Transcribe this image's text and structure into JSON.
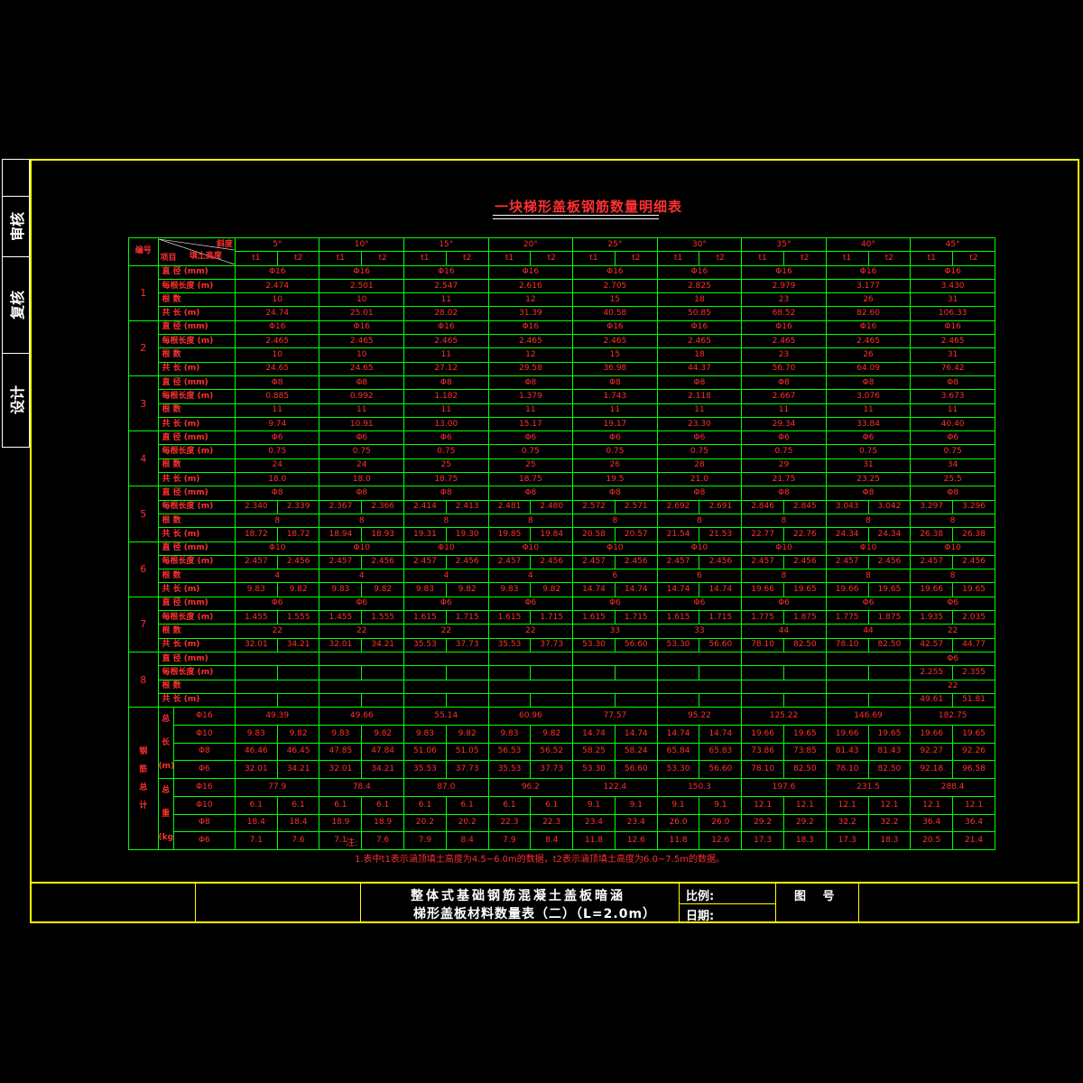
{
  "side": [
    "审核",
    "复核",
    "设计"
  ],
  "title": "一块梯形盖板钢筋数量明细表",
  "header": {
    "no_label": "编号",
    "angle_label": "斜度",
    "item_label": "项目",
    "fill_label": "填土高度",
    "angles": [
      "5°",
      "10°",
      "15°",
      "20°",
      "25°",
      "30°",
      "35°",
      "40°",
      "45°"
    ],
    "t1": "t1",
    "t2": "t2"
  },
  "row_labels": {
    "dia": "直 径 (mm)",
    "len": "每根长度 (m)",
    "cnt": "根 数",
    "tot": "共 长 (m)"
  },
  "groups": [
    {
      "no": "1",
      "rows": [
        {
          "k": "dia",
          "cells": [
            "Φ16",
            "Φ16",
            "Φ16",
            "Φ16",
            "Φ16",
            "Φ16",
            "Φ16",
            "Φ16",
            "Φ16"
          ]
        },
        {
          "k": "len",
          "cells": [
            "2.474",
            "2.501",
            "2.547",
            "2.616",
            "2.705",
            "2.825",
            "2.979",
            "3.177",
            "3.430"
          ]
        },
        {
          "k": "cnt",
          "cells": [
            "10",
            "10",
            "11",
            "12",
            "15",
            "18",
            "23",
            "26",
            "31"
          ]
        },
        {
          "k": "tot",
          "cells": [
            "24.74",
            "25.01",
            "28.02",
            "31.39",
            "40.58",
            "50.85",
            "68.52",
            "82.60",
            "106.33"
          ]
        }
      ]
    },
    {
      "no": "2",
      "rows": [
        {
          "k": "dia",
          "cells": [
            "Φ16",
            "Φ16",
            "Φ16",
            "Φ16",
            "Φ16",
            "Φ16",
            "Φ16",
            "Φ16",
            "Φ16"
          ]
        },
        {
          "k": "len",
          "cells": [
            "2.465",
            "2.465",
            "2.465",
            "2.465",
            "2.465",
            "2.465",
            "2.465",
            "2.465",
            "2.465"
          ]
        },
        {
          "k": "cnt",
          "cells": [
            "10",
            "10",
            "11",
            "12",
            "15",
            "18",
            "23",
            "26",
            "31"
          ]
        },
        {
          "k": "tot",
          "cells": [
            "24.65",
            "24.65",
            "27.12",
            "29.58",
            "36.98",
            "44.37",
            "56.70",
            "64.09",
            "76.42"
          ]
        }
      ]
    },
    {
      "no": "3",
      "rows": [
        {
          "k": "dia",
          "cells": [
            "Φ8",
            "Φ8",
            "Φ8",
            "Φ8",
            "Φ8",
            "Φ8",
            "Φ8",
            "Φ8",
            "Φ8"
          ]
        },
        {
          "k": "len",
          "cells": [
            "0.885",
            "0.992",
            "1.182",
            "1.379",
            "1.743",
            "2.118",
            "2.667",
            "3.076",
            "3.673"
          ]
        },
        {
          "k": "cnt",
          "cells": [
            "11",
            "11",
            "11",
            "11",
            "11",
            "11",
            "11",
            "11",
            "11"
          ]
        },
        {
          "k": "tot",
          "cells": [
            "9.74",
            "10.91",
            "13.00",
            "15.17",
            "19.17",
            "23.30",
            "29.34",
            "33.84",
            "40.40"
          ]
        }
      ]
    },
    {
      "no": "4",
      "rows": [
        {
          "k": "dia",
          "cells": [
            "Φ6",
            "Φ6",
            "Φ6",
            "Φ6",
            "Φ6",
            "Φ6",
            "Φ6",
            "Φ6",
            "Φ6"
          ]
        },
        {
          "k": "len",
          "cells": [
            "0.75",
            "0.75",
            "0.75",
            "0.75",
            "0.75",
            "0.75",
            "0.75",
            "0.75",
            "0.75"
          ]
        },
        {
          "k": "cnt",
          "cells": [
            "24",
            "24",
            "25",
            "25",
            "26",
            "28",
            "29",
            "31",
            "34"
          ]
        },
        {
          "k": "tot",
          "cells": [
            "18.0",
            "18.0",
            "18.75",
            "18.75",
            "19.5",
            "21.0",
            "21.75",
            "23.25",
            "25.5"
          ]
        }
      ]
    },
    {
      "no": "5",
      "rows": [
        {
          "k": "dia",
          "cells": [
            "Φ8",
            "Φ8",
            "Φ8",
            "Φ8",
            "Φ8",
            "Φ8",
            "Φ8",
            "Φ8",
            "Φ8"
          ]
        },
        {
          "k": "len",
          "split": true,
          "cells": [
            [
              "2.340",
              "2.339"
            ],
            [
              "2.367",
              "2.366"
            ],
            [
              "2.414",
              "2.413"
            ],
            [
              "2.481",
              "2.480"
            ],
            [
              "2.572",
              "2.571"
            ],
            [
              "2.692",
              "2.691"
            ],
            [
              "2.846",
              "2.845"
            ],
            [
              "3.043",
              "3.042"
            ],
            [
              "3.297",
              "3.296"
            ]
          ]
        },
        {
          "k": "cnt",
          "cells": [
            "8",
            "8",
            "8",
            "8",
            "8",
            "8",
            "8",
            "8",
            "8"
          ]
        },
        {
          "k": "tot",
          "split": true,
          "cells": [
            [
              "18.72",
              "18.72"
            ],
            [
              "18.94",
              "18.93"
            ],
            [
              "19.31",
              "19.30"
            ],
            [
              "19.85",
              "19.84"
            ],
            [
              "20.58",
              "20.57"
            ],
            [
              "21.54",
              "21.53"
            ],
            [
              "22.77",
              "22.76"
            ],
            [
              "24.34",
              "24.34"
            ],
            [
              "26.38",
              "26.38"
            ]
          ]
        }
      ]
    },
    {
      "no": "6",
      "rows": [
        {
          "k": "dia",
          "cells": [
            "Φ10",
            "Φ10",
            "Φ10",
            "Φ10",
            "Φ10",
            "Φ10",
            "Φ10",
            "Φ10",
            "Φ10"
          ]
        },
        {
          "k": "len",
          "split": true,
          "cells": [
            [
              "2.457",
              "2.456"
            ],
            [
              "2.457",
              "2.456"
            ],
            [
              "2.457",
              "2.456"
            ],
            [
              "2.457",
              "2.456"
            ],
            [
              "2.457",
              "2.456"
            ],
            [
              "2.457",
              "2.456"
            ],
            [
              "2.457",
              "2.456"
            ],
            [
              "2.457",
              "2.456"
            ],
            [
              "2.457",
              "2.456"
            ]
          ]
        },
        {
          "k": "cnt",
          "cells": [
            "4",
            "4",
            "4",
            "4",
            "6",
            "6",
            "8",
            "8",
            "8"
          ]
        },
        {
          "k": "tot",
          "split": true,
          "cells": [
            [
              "9.83",
              "9.82"
            ],
            [
              "9.83",
              "9.82"
            ],
            [
              "9.83",
              "9.82"
            ],
            [
              "9.83",
              "9.82"
            ],
            [
              "14.74",
              "14.74"
            ],
            [
              "14.74",
              "14.74"
            ],
            [
              "19.66",
              "19.65"
            ],
            [
              "19.66",
              "19.65"
            ],
            [
              "19.66",
              "19.65"
            ]
          ]
        }
      ]
    },
    {
      "no": "7",
      "rows": [
        {
          "k": "dia",
          "cells": [
            "Φ6",
            "Φ6",
            "Φ6",
            "Φ6",
            "Φ6",
            "Φ6",
            "Φ6",
            "Φ6",
            "Φ6"
          ]
        },
        {
          "k": "len",
          "split": true,
          "cells": [
            [
              "1.455",
              "1.555"
            ],
            [
              "1.455",
              "1.555"
            ],
            [
              "1.615",
              "1.715"
            ],
            [
              "1.615",
              "1.715"
            ],
            [
              "1.615",
              "1.715"
            ],
            [
              "1.615",
              "1.715"
            ],
            [
              "1.775",
              "1.875"
            ],
            [
              "1.775",
              "1.875"
            ],
            [
              "1.935",
              "2.035"
            ]
          ]
        },
        {
          "k": "cnt",
          "cells": [
            "22",
            "22",
            "22",
            "22",
            "33",
            "33",
            "44",
            "44",
            "22"
          ]
        },
        {
          "k": "tot",
          "split": true,
          "cells": [
            [
              "32.01",
              "34.21"
            ],
            [
              "32.01",
              "34.21"
            ],
            [
              "35.53",
              "37.73"
            ],
            [
              "35.53",
              "37.73"
            ],
            [
              "53.30",
              "56.60"
            ],
            [
              "53.30",
              "56.60"
            ],
            [
              "78.10",
              "82.50"
            ],
            [
              "78.10",
              "82.50"
            ],
            [
              "42.57",
              "44.77"
            ]
          ]
        }
      ]
    },
    {
      "no": "8",
      "rows": [
        {
          "k": "dia",
          "cells": [
            "",
            "",
            "",
            "",
            "",
            "",
            "",
            "",
            "Φ6"
          ]
        },
        {
          "k": "len",
          "split": true,
          "cells": [
            [
              "",
              ""
            ],
            [
              "",
              ""
            ],
            [
              "",
              ""
            ],
            [
              "",
              ""
            ],
            [
              "",
              ""
            ],
            [
              "",
              ""
            ],
            [
              "",
              ""
            ],
            [
              "",
              ""
            ],
            [
              "2.255",
              "2.355"
            ]
          ]
        },
        {
          "k": "cnt",
          "cells": [
            "",
            "",
            "",
            "",
            "",
            "",
            "",
            "",
            "22"
          ]
        },
        {
          "k": "tot",
          "split": true,
          "cells": [
            [
              "",
              ""
            ],
            [
              "",
              ""
            ],
            [
              "",
              ""
            ],
            [
              "",
              ""
            ],
            [
              "",
              ""
            ],
            [
              "",
              ""
            ],
            [
              "",
              ""
            ],
            [
              "",
              ""
            ],
            [
              "49.61",
              "51.81"
            ]
          ]
        }
      ]
    }
  ],
  "summary": {
    "label": "钢筋总计",
    "len_label": "总 长",
    "len_unit": "(m)",
    "wt_label": "总 重",
    "wt_unit": "(kg)",
    "len_rows": [
      {
        "d": "Φ16",
        "cells": [
          "49.39",
          "49.66",
          "55.14",
          "60.96",
          "77.57",
          "95.22",
          "125.22",
          "146.69",
          "182.75"
        ]
      },
      {
        "d": "Φ10",
        "split": true,
        "cells": [
          [
            "9.83",
            "9.82"
          ],
          [
            "9.83",
            "9.82"
          ],
          [
            "9.83",
            "9.82"
          ],
          [
            "9.83",
            "9.82"
          ],
          [
            "14.74",
            "14.74"
          ],
          [
            "14.74",
            "14.74"
          ],
          [
            "19.66",
            "19.65"
          ],
          [
            "19.66",
            "19.65"
          ],
          [
            "19.66",
            "19.65"
          ]
        ]
      },
      {
        "d": "Φ8",
        "split": true,
        "cells": [
          [
            "46.46",
            "46.45"
          ],
          [
            "47.85",
            "47.84"
          ],
          [
            "51.06",
            "51.05"
          ],
          [
            "56.53",
            "56.52"
          ],
          [
            "58.25",
            "58.24"
          ],
          [
            "65.84",
            "65.83"
          ],
          [
            "73.86",
            "73.85"
          ],
          [
            "81.43",
            "81.43"
          ],
          [
            "92.27",
            "92.26"
          ]
        ]
      },
      {
        "d": "Φ6",
        "split": true,
        "cells": [
          [
            "32.01",
            "34.21"
          ],
          [
            "32.01",
            "34.21"
          ],
          [
            "35.53",
            "37.73"
          ],
          [
            "35.53",
            "37.73"
          ],
          [
            "53.30",
            "56.60"
          ],
          [
            "53.30",
            "56.60"
          ],
          [
            "78.10",
            "82.50"
          ],
          [
            "78.10",
            "82.50"
          ],
          [
            "92.18",
            "96.58"
          ]
        ]
      }
    ],
    "wt_rows": [
      {
        "d": "Φ16",
        "cells": [
          "77.9",
          "78.4",
          "87.0",
          "96.2",
          "122.4",
          "150.3",
          "197.6",
          "231.5",
          "288.4"
        ]
      },
      {
        "d": "Φ10",
        "split": true,
        "cells": [
          [
            "6.1",
            "6.1"
          ],
          [
            "6.1",
            "6.1"
          ],
          [
            "6.1",
            "6.1"
          ],
          [
            "6.1",
            "6.1"
          ],
          [
            "9.1",
            "9.1"
          ],
          [
            "9.1",
            "9.1"
          ],
          [
            "12.1",
            "12.1"
          ],
          [
            "12.1",
            "12.1"
          ],
          [
            "12.1",
            "12.1"
          ]
        ]
      },
      {
        "d": "Φ8",
        "split": true,
        "cells": [
          [
            "18.4",
            "18.4"
          ],
          [
            "18.9",
            "18.9"
          ],
          [
            "20.2",
            "20.2"
          ],
          [
            "22.3",
            "22.3"
          ],
          [
            "23.4",
            "23.4"
          ],
          [
            "26.0",
            "26.0"
          ],
          [
            "29.2",
            "29.2"
          ],
          [
            "32.2",
            "32.2"
          ],
          [
            "36.4",
            "36.4"
          ]
        ]
      },
      {
        "d": "Φ6",
        "split": true,
        "cells": [
          [
            "7.1",
            "7.6"
          ],
          [
            "7.1",
            "7.6"
          ],
          [
            "7.9",
            "8.4"
          ],
          [
            "7.9",
            "8.4"
          ],
          [
            "11.8",
            "12.6"
          ],
          [
            "11.8",
            "12.6"
          ],
          [
            "17.3",
            "18.3"
          ],
          [
            "17.3",
            "18.3"
          ],
          [
            "20.5",
            "21.4"
          ]
        ]
      }
    ]
  },
  "notes": {
    "head": "注:",
    "line1": "1.表中t1表示涵顶填土高度为4.5~6.0m的数据，t2表示涵顶填土高度为6.0~7.5m的数据。"
  },
  "title_block": {
    "title1": "整体式基础钢筋混凝土盖板暗涵",
    "title2": "梯形盖板材料数量表（二）（L=2.0m）",
    "scale_label": "比例:",
    "date_label": "日期:",
    "drawing_no_label": "图 号"
  },
  "colors": {
    "frame": "#ffff00",
    "grid": "#00ff00",
    "text": "#ff3030",
    "bg": "#000000"
  }
}
